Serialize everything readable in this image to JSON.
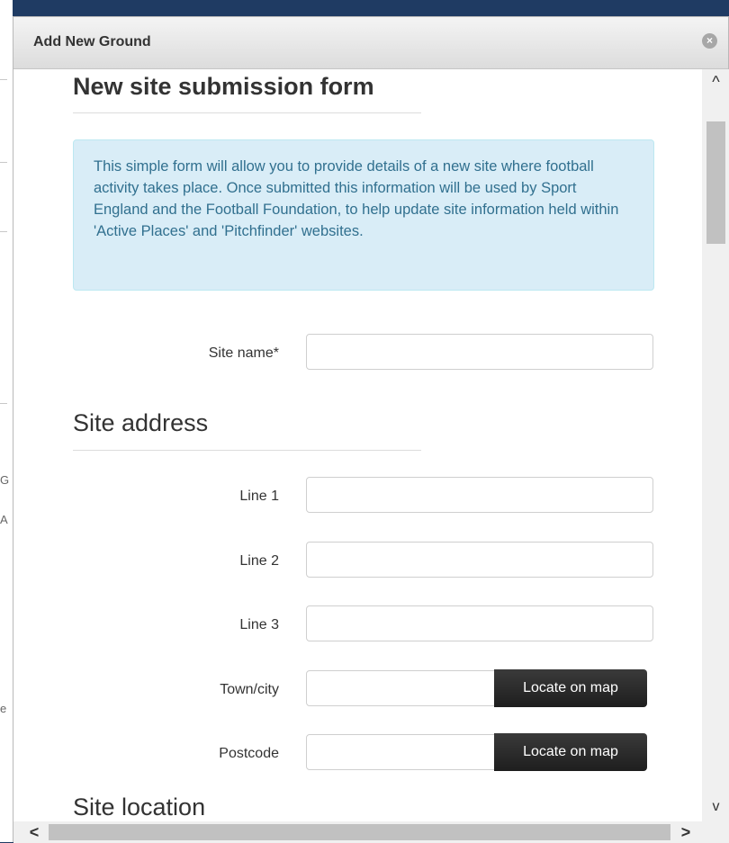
{
  "dialog": {
    "title": "Add New Ground",
    "close_glyph": "×"
  },
  "form": {
    "heading": "New site submission form",
    "info_text": "This simple form will allow you to provide details of a new site where football activity takes place. Once submitted this information will be used by Sport England and the Football Foundation, to help update site information held within 'Active Places' and 'Pitchfinder' websites.",
    "site_name_label": "Site name*",
    "site_name_value": "",
    "address_heading": "Site address",
    "line1_label": "Line 1",
    "line2_label": "Line 2",
    "line3_label": "Line 3",
    "town_label": "Town/city",
    "postcode_label": "Postcode",
    "locate_button": "Locate on map",
    "location_heading": "Site location"
  },
  "scrollbars": {
    "up": "^",
    "down": "v",
    "left": "<",
    "right": ">"
  },
  "background": {
    "glyph_1": "G",
    "glyph_2": "A",
    "glyph_3": "e"
  }
}
